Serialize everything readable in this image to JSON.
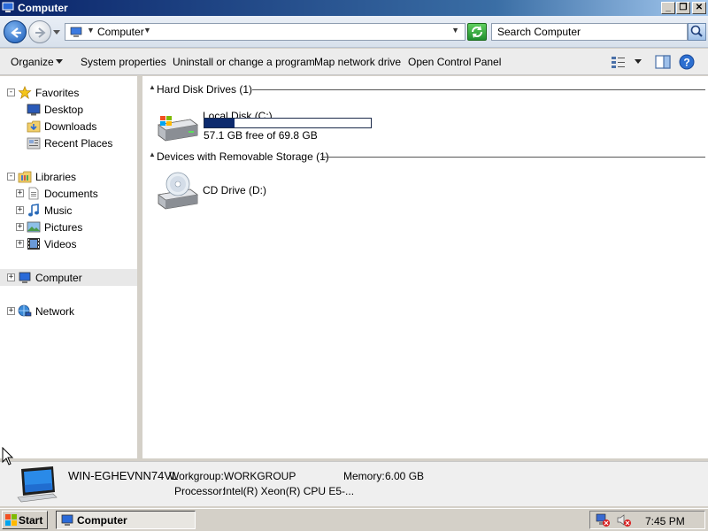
{
  "window": {
    "title": "Computer",
    "icon": "computer-icon",
    "controls": [
      "minimize",
      "restore",
      "close"
    ],
    "accent": "#0a246a"
  },
  "navigation": {
    "back_icon": "back-arrow-icon",
    "forward_icon": "forward-arrow-icon",
    "address": {
      "icon": "computer-icon",
      "path": "Computer"
    },
    "refresh_icon": "refresh-icon",
    "search": {
      "placeholder": "Search Computer",
      "icon": "search-icon"
    }
  },
  "toolbar": {
    "items": [
      {
        "label": "Organize",
        "has_dropdown": true
      },
      {
        "label": "System properties"
      },
      {
        "label": "Uninstall or change a program"
      },
      {
        "label": "Map network drive"
      },
      {
        "label": "Open Control Panel"
      }
    ],
    "right_icons": [
      "view-options-icon",
      "preview-pane-icon",
      "help-icon"
    ]
  },
  "sidebar": {
    "favorites": {
      "label": "Favorites",
      "items": [
        {
          "label": "Desktop",
          "icon": "desktop-icon"
        },
        {
          "label": "Downloads",
          "icon": "downloads-icon"
        },
        {
          "label": "Recent Places",
          "icon": "recent-places-icon"
        }
      ]
    },
    "libraries": {
      "label": "Libraries",
      "items": [
        {
          "label": "Documents",
          "icon": "documents-icon"
        },
        {
          "label": "Music",
          "icon": "music-icon"
        },
        {
          "label": "Pictures",
          "icon": "pictures-icon"
        },
        {
          "label": "Videos",
          "icon": "videos-icon"
        }
      ]
    },
    "computer": {
      "label": "Computer",
      "selected": true
    },
    "network": {
      "label": "Network"
    }
  },
  "content": {
    "groups": [
      {
        "title": "Hard Disk Drives (1)",
        "drives": [
          {
            "name": "Local Disk (C:)",
            "free_text": "57.1 GB free of 69.8 GB",
            "used_fraction": 0.182,
            "icon": "hard-disk-icon"
          }
        ]
      },
      {
        "title": "Devices with Removable Storage (1)",
        "drives": [
          {
            "name": "CD Drive (D:)",
            "icon": "cd-drive-icon"
          }
        ]
      }
    ],
    "usage_bar_color": "#0c2a6e"
  },
  "details": {
    "computer_name": "WIN-EGHEVNN74VL",
    "workgroup_label": "Workgroup:",
    "workgroup": "WORKGROUP",
    "memory_label": "Memory:",
    "memory": "6.00 GB",
    "processor_label": "Processor:",
    "processor": "Intel(R) Xeon(R) CPU E5-..."
  },
  "taskbar": {
    "start_label": "Start",
    "task_label": "Computer",
    "tray_icons": [
      "network-disconnected-icon",
      "volume-muted-icon"
    ],
    "clock": "7:45 PM"
  }
}
